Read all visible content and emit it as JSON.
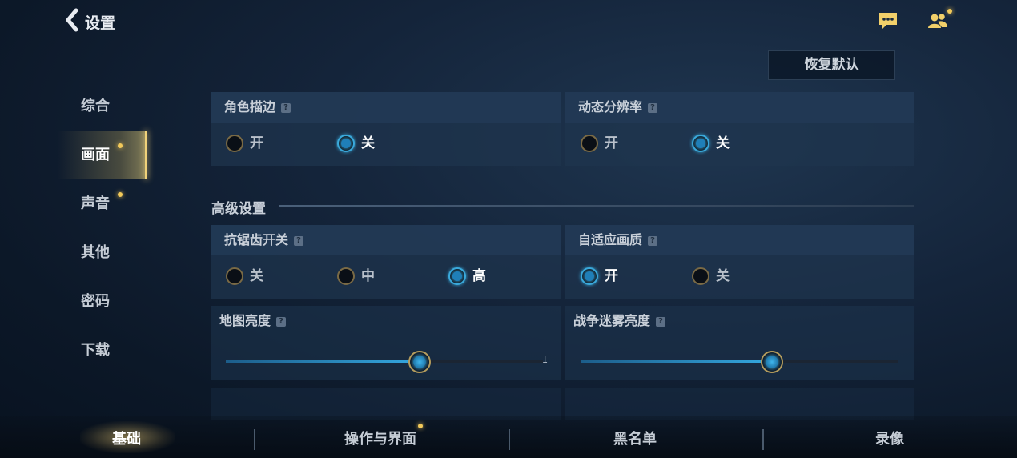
{
  "header": {
    "title": "设置"
  },
  "reset_button": "恢复默认",
  "sidebar": {
    "items": [
      {
        "label": "综合"
      },
      {
        "label": "画面"
      },
      {
        "label": "声音"
      },
      {
        "label": "其他"
      },
      {
        "label": "密码"
      },
      {
        "label": "下载"
      }
    ],
    "active": "画面"
  },
  "panels": {
    "outline": {
      "title": "角色描边",
      "options": [
        "开",
        "关"
      ],
      "selected": "关"
    },
    "dynamic_res": {
      "title": "动态分辨率",
      "options": [
        "开",
        "关"
      ],
      "selected": "关"
    },
    "antialias": {
      "title": "抗锯齿开关",
      "options": [
        "关",
        "中",
        "高"
      ],
      "selected": "高"
    },
    "adaptive": {
      "title": "自适应画质",
      "options": [
        "开",
        "关"
      ],
      "selected": "开"
    },
    "map_brightness": {
      "title": "地图亮度",
      "value": 0.61
    },
    "fog_brightness": {
      "title": "战争迷雾亮度",
      "value": 0.6
    }
  },
  "advanced": {
    "title": "高级设置"
  },
  "help_glyph": "?",
  "bottom_tabs": [
    {
      "label": "基础"
    },
    {
      "label": "操作与界面"
    },
    {
      "label": "黑名单"
    },
    {
      "label": "录像"
    }
  ],
  "colors": {
    "accent_blue": "#34a8e0",
    "accent_gold": "#f0d27a",
    "notify_dot": "#f2c95a"
  }
}
